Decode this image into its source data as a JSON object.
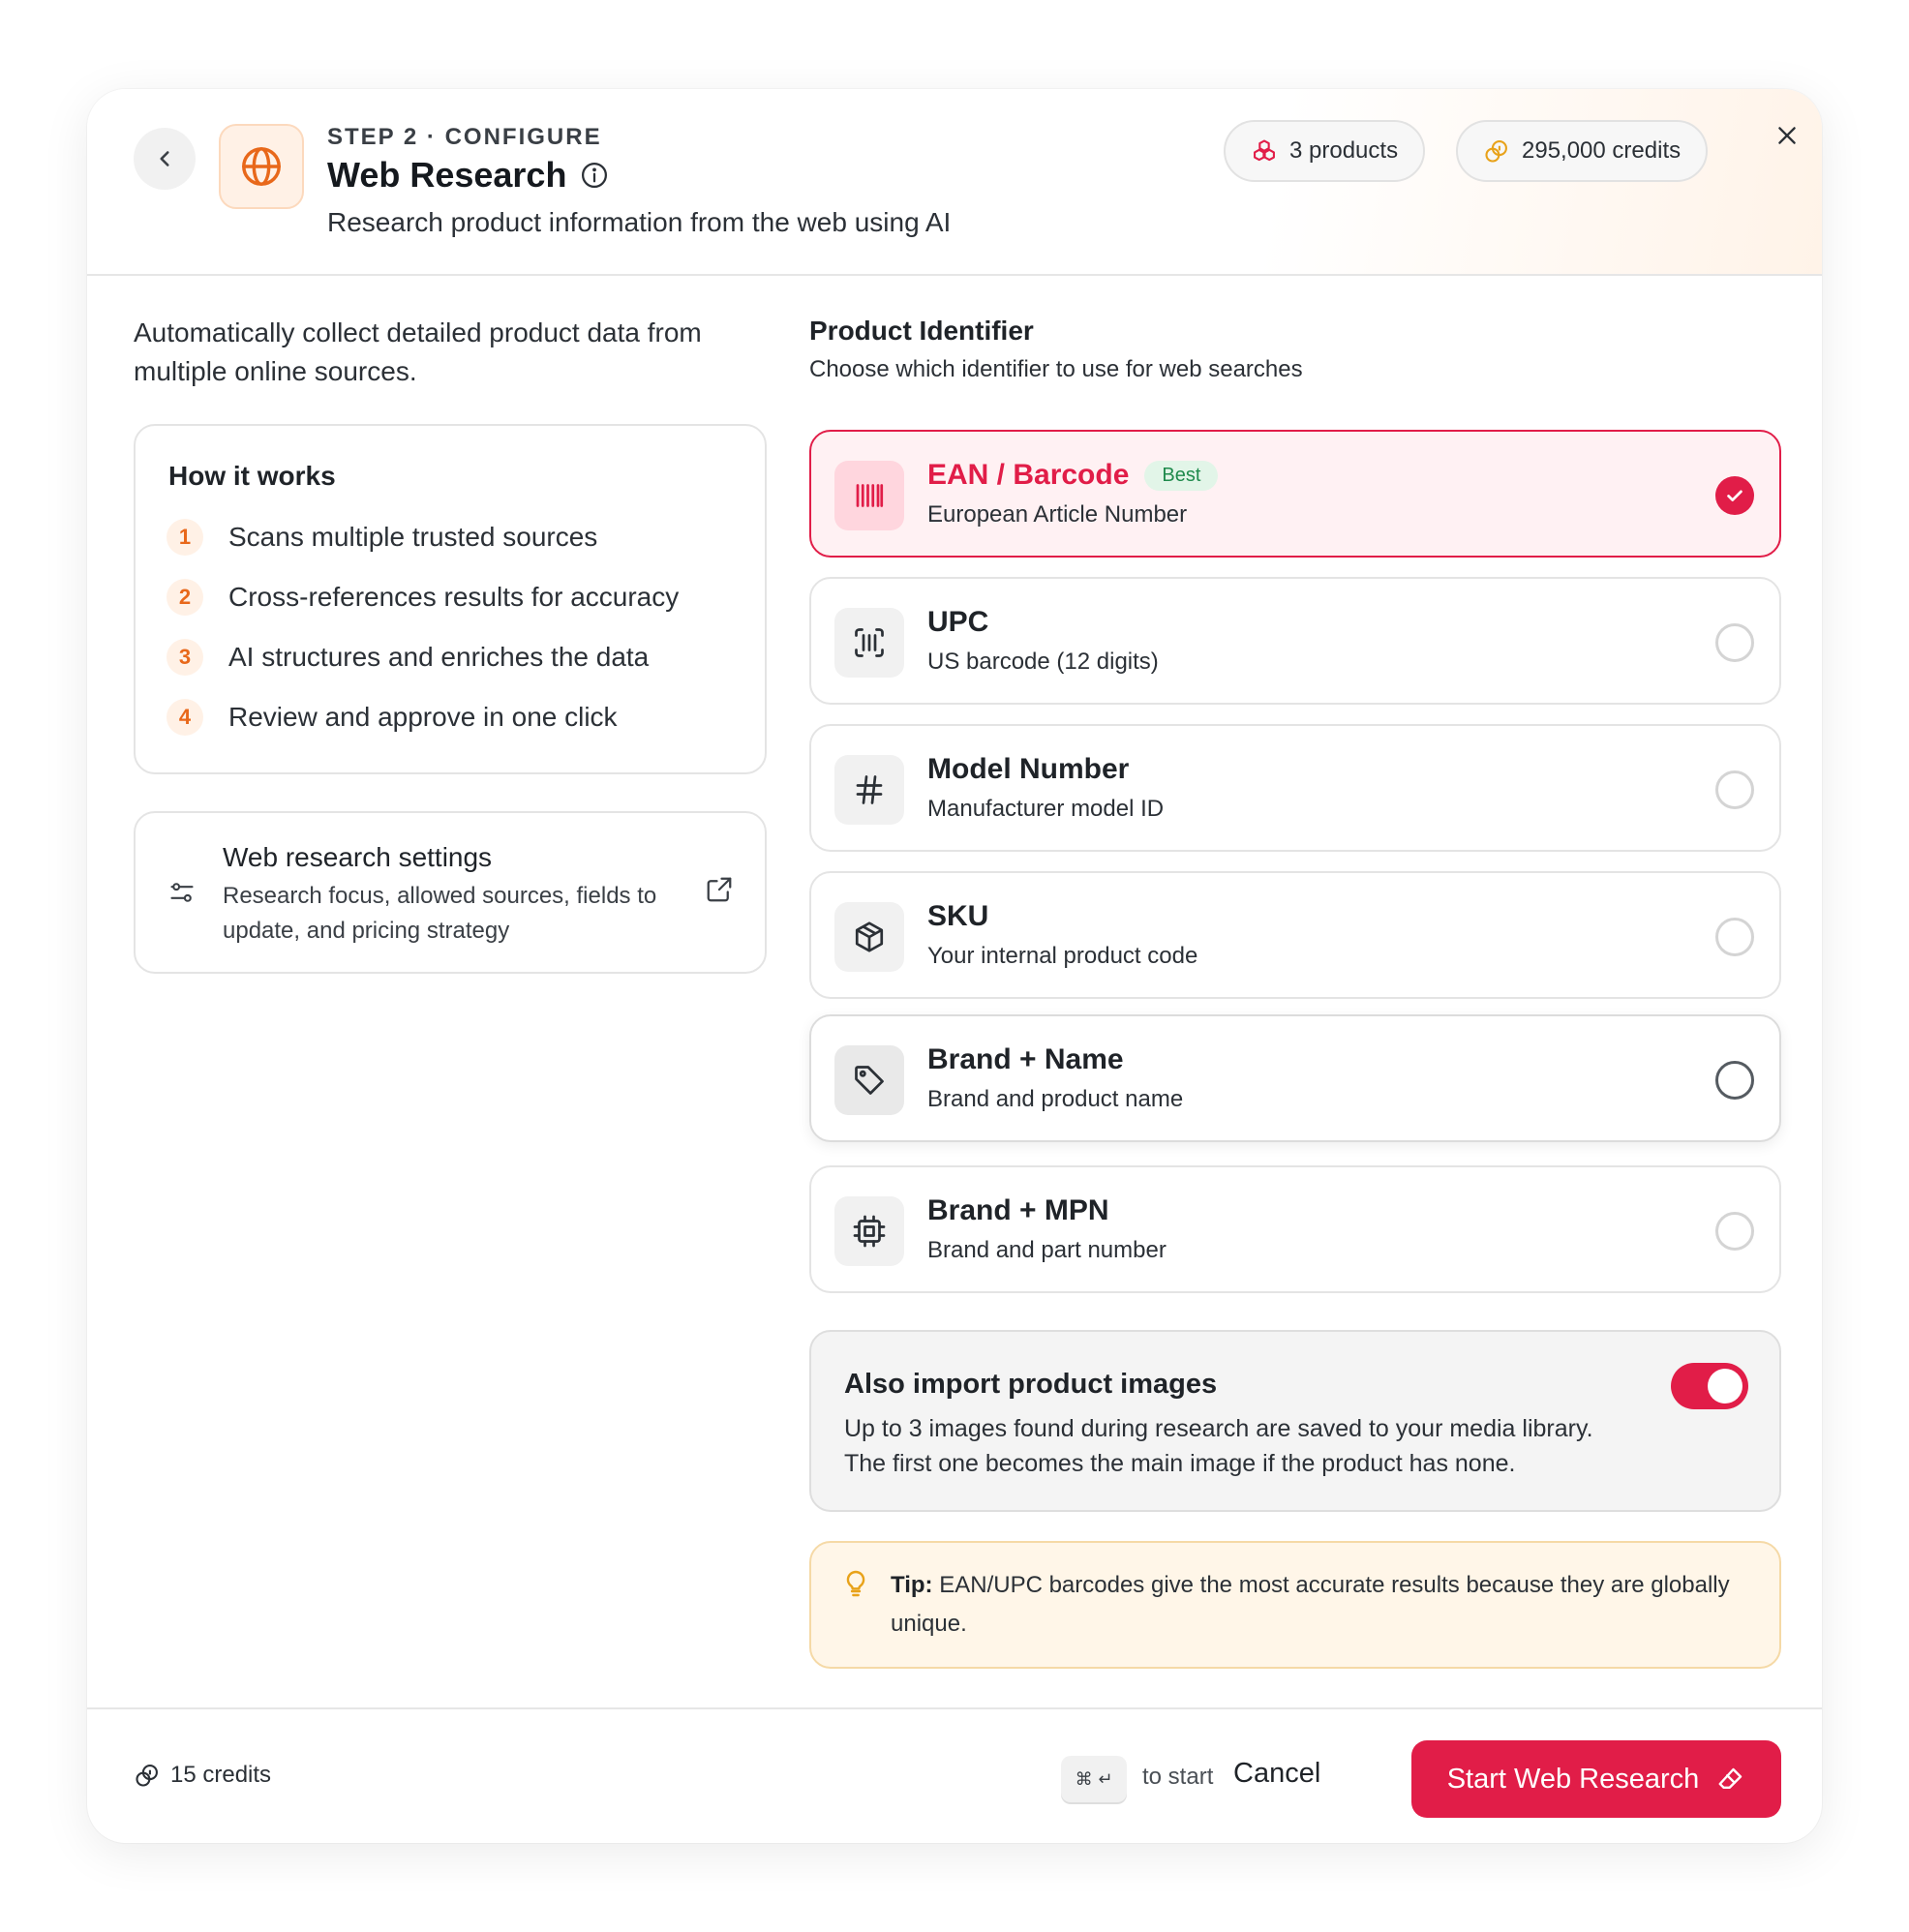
{
  "header": {
    "step": "STEP 2 · CONFIGURE",
    "title": "Web Research",
    "subtitle": "Research product information from the web using AI",
    "products_pill": "3 products",
    "credits_pill": "295,000 credits"
  },
  "left": {
    "intro": "Automatically collect detailed product data from multiple online sources.",
    "how_it_works": {
      "title": "How it works",
      "steps": [
        {
          "num": "1",
          "text": "Scans multiple trusted sources"
        },
        {
          "num": "2",
          "text": "Cross-references results for accuracy"
        },
        {
          "num": "3",
          "text": "AI structures and enriches the data"
        },
        {
          "num": "4",
          "text": "Review and approve in one click"
        }
      ]
    },
    "settings": {
      "title": "Web research settings",
      "description": "Research focus, allowed sources, fields to update, and pricing strategy"
    }
  },
  "product_identifier": {
    "title": "Product Identifier",
    "subtitle": "Choose which identifier to use for web searches",
    "selected": "EAN / Barcode",
    "options": [
      {
        "label": "EAN / Barcode",
        "badge": "Best",
        "desc": "European Article Number",
        "icon": "barcode-icon"
      },
      {
        "label": "UPC",
        "desc": "US barcode (12 digits)",
        "icon": "scan-barcode-icon"
      },
      {
        "label": "Model Number",
        "desc": "Manufacturer model ID",
        "icon": "hash-icon"
      },
      {
        "label": "SKU",
        "desc": "Your internal product code",
        "icon": "package-icon"
      },
      {
        "label": "Brand + Name",
        "desc": "Brand and product name",
        "icon": "tag-icon"
      },
      {
        "label": "Brand + MPN",
        "desc": "Brand and part number",
        "icon": "chip-icon"
      }
    ]
  },
  "images": {
    "title": "Also import product images",
    "description": "Up to 3 images found during research are saved to your media library. The first one becomes the main image if the product has none.",
    "enabled": true
  },
  "tip": {
    "label": "Tip:",
    "text": "EAN/UPC barcodes give the most accurate results because they are globally unique."
  },
  "footer": {
    "credits": "15 credits",
    "shortcut": "⌘ ↵",
    "shortcut_hint": "to start",
    "cancel": "Cancel",
    "start": "Start Web Research"
  },
  "colors": {
    "accent": "#e11d48",
    "orange": "#e8681a",
    "tip_bg": "#fff6e8"
  }
}
